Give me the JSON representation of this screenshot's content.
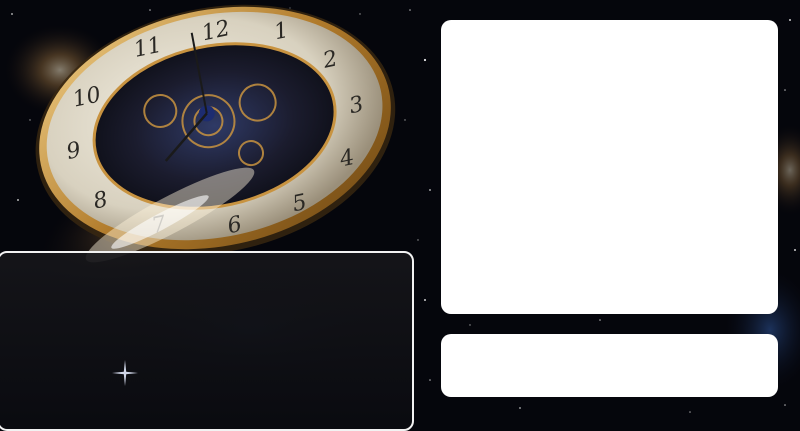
{
  "image": {
    "subject": "pocket-watch-in-space",
    "colors": {
      "space": "#05060c",
      "nebula": "#b88a4a",
      "panel": "#ffffff",
      "dark_panel": "#121318",
      "dark_panel_border": "#f2f2f2"
    },
    "clock": {
      "numerals": [
        "12",
        "1",
        "2",
        "3",
        "4",
        "5",
        "6",
        "7",
        "8",
        "9",
        "10",
        "11"
      ]
    }
  },
  "panels": {
    "main": {
      "content": ""
    },
    "secondary": {
      "content": ""
    },
    "dark": {
      "content": ""
    }
  }
}
